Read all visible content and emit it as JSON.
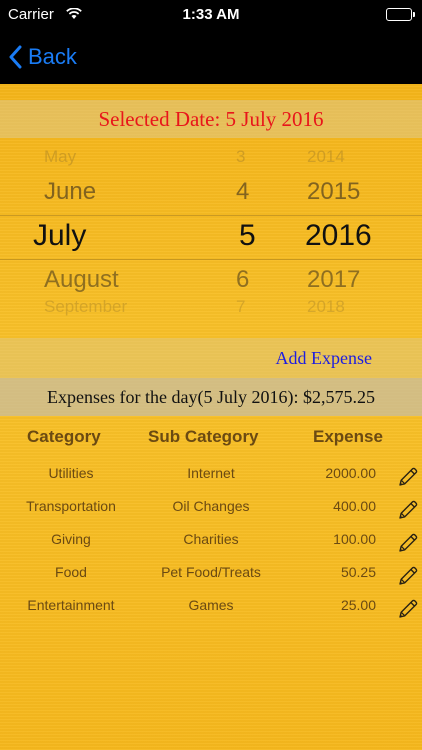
{
  "status_bar": {
    "carrier": "Carrier",
    "time": "1:33 AM"
  },
  "nav": {
    "back_label": "Back"
  },
  "selected_date": "Selected Date: 5 July 2016",
  "picker": {
    "months": [
      "May",
      "June",
      "July",
      "August",
      "September"
    ],
    "days": [
      "3",
      "4",
      "5",
      "6",
      "7"
    ],
    "years": [
      "2014",
      "2015",
      "2016",
      "2017",
      "2018"
    ],
    "selected": {
      "month": "July",
      "day": "5",
      "year": "2016"
    }
  },
  "add_expense_label": "Add Expense",
  "total_label": "Expenses for the day(5 July 2016): $2,575.25",
  "table": {
    "headers": [
      "Category",
      "Sub Category",
      "Expense"
    ],
    "rows": [
      {
        "category": "Utilities",
        "sub_category": "Internet",
        "expense": "2000.00"
      },
      {
        "category": "Transportation",
        "sub_category": "Oil Changes",
        "expense": "400.00"
      },
      {
        "category": "Giving",
        "sub_category": "Charities",
        "expense": "100.00"
      },
      {
        "category": "Food",
        "sub_category": "Pet Food/Treats",
        "expense": "50.25"
      },
      {
        "category": "Entertainment",
        "sub_category": "Games",
        "expense": "25.00"
      }
    ]
  },
  "colors": {
    "background": "#f7b81e",
    "selected_date_text": "#e8161b",
    "link": "#1d1de0",
    "back": "#1a7cf5",
    "table_text": "#6b4a12"
  },
  "icons": {
    "back": "chevron-left-icon",
    "edit": "pencil-icon",
    "wifi": "wifi-icon",
    "battery": "battery-icon"
  }
}
